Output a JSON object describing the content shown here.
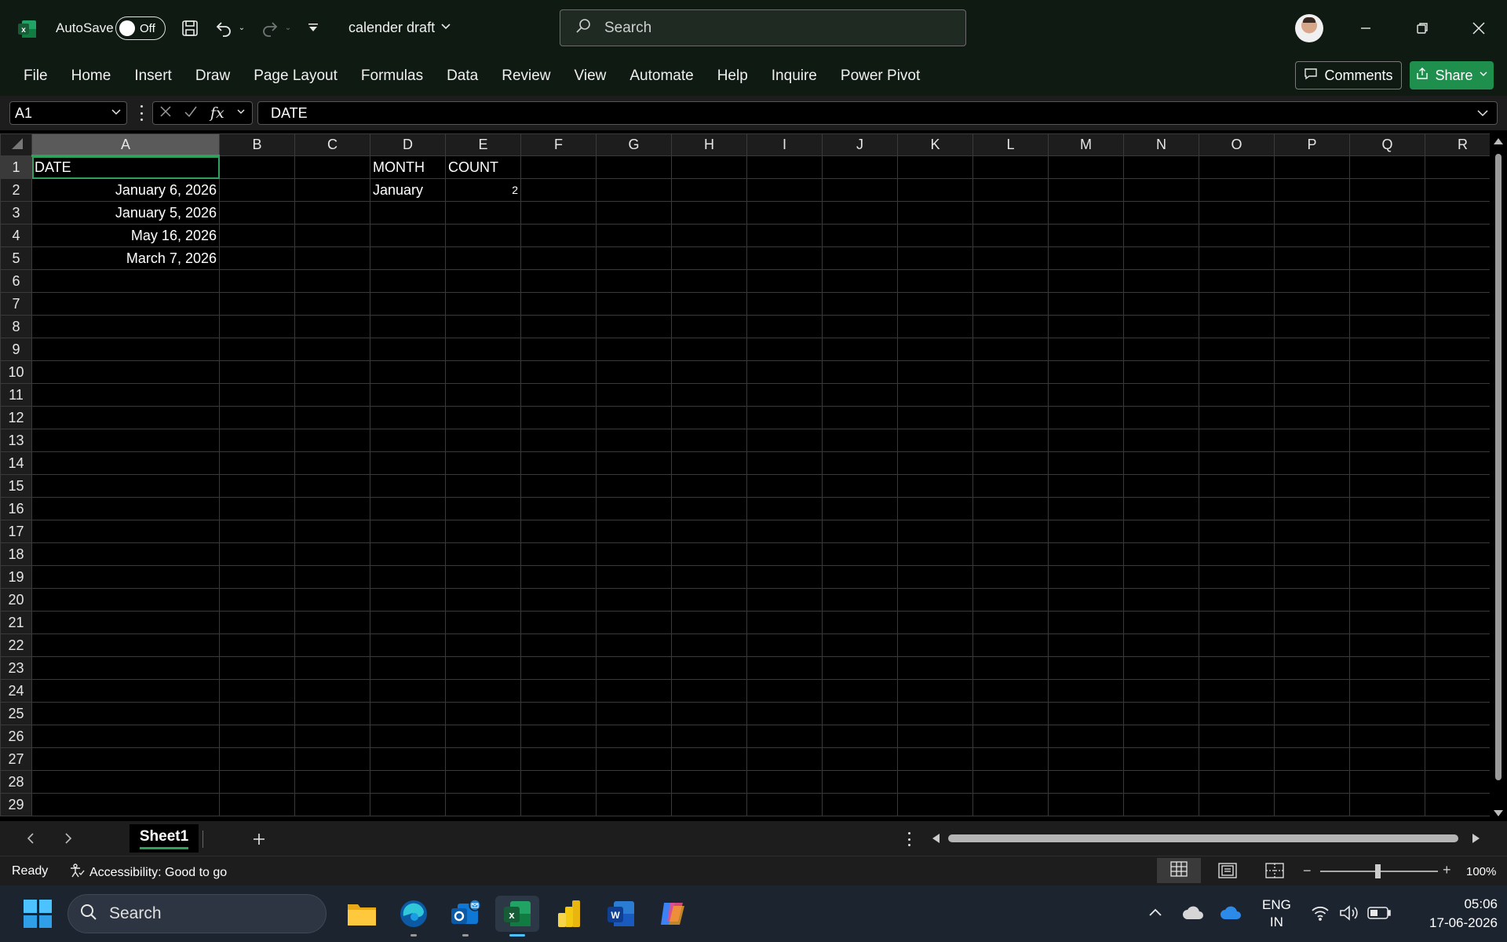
{
  "titlebar": {
    "autosave_label": "AutoSave",
    "autosave_state": "Off",
    "file_name": "calender draft",
    "search_placeholder": "Search"
  },
  "ribbon": {
    "tabs": [
      "File",
      "Home",
      "Insert",
      "Draw",
      "Page Layout",
      "Formulas",
      "Data",
      "Review",
      "View",
      "Automate",
      "Help",
      "Inquire",
      "Power Pivot"
    ],
    "comments_label": "Comments",
    "share_label": "Share"
  },
  "formula_bar": {
    "name_box": "A1",
    "fx": "fx",
    "content": "DATE"
  },
  "grid": {
    "columns": [
      "A",
      "B",
      "C",
      "D",
      "E",
      "F",
      "G",
      "H",
      "I",
      "J",
      "K",
      "L",
      "M",
      "N",
      "O",
      "P",
      "Q",
      "R"
    ],
    "row_count": 29,
    "cells": {
      "A1": "DATE",
      "A2": "January 6, 2026",
      "A3": "January 5, 2026",
      "A4": "May 16, 2026",
      "A5": "March 7, 2026",
      "D1": "MONTH",
      "E1": "COUNT",
      "D2": "January",
      "E2": "2"
    },
    "selected_cell": "A1"
  },
  "sheets": {
    "tabs": [
      "Sheet1"
    ],
    "active": "Sheet1"
  },
  "status": {
    "ready": "Ready",
    "accessibility": "Accessibility: Good to go",
    "zoom": "100%"
  },
  "taskbar": {
    "search_placeholder": "Search",
    "lang_line1": "ENG",
    "lang_line2": "IN",
    "time": "05:06",
    "date": "17-06-2026"
  },
  "colors": {
    "excel_green": "#1e7145",
    "accent_green": "#2ea25d",
    "share_green": "#1f8f4e"
  }
}
